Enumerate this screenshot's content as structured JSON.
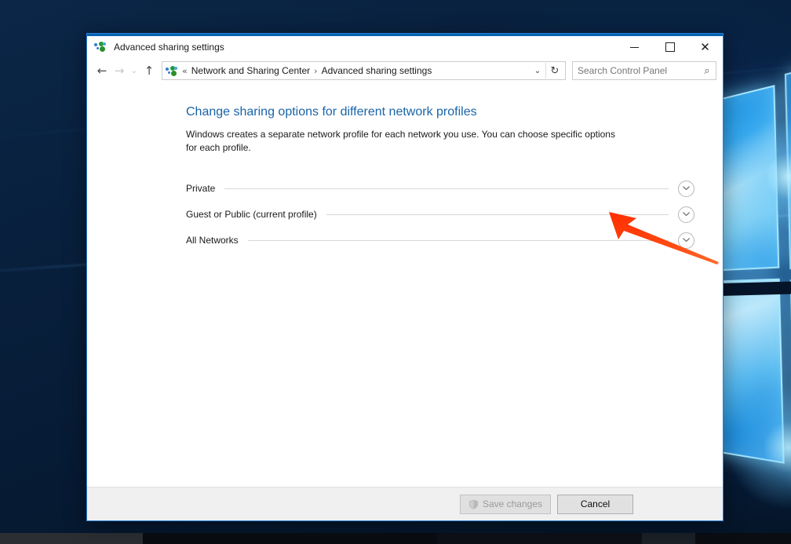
{
  "window": {
    "title": "Advanced sharing settings",
    "icon": "network-sharing-icon",
    "controls": {
      "minimize": "─",
      "maximize": "□",
      "close": "✕"
    }
  },
  "navigation": {
    "back": "←",
    "forward": "→",
    "recent": "⌄",
    "up": "↑"
  },
  "breadcrumb": {
    "leading_separator": "«",
    "separator": "›",
    "items": [
      {
        "label": "Network and Sharing Center"
      },
      {
        "label": "Advanced sharing settings"
      }
    ],
    "dropdown": "⌄",
    "refresh": "↻"
  },
  "search": {
    "placeholder": "Search Control Panel",
    "value": "",
    "icon": "search-icon"
  },
  "main": {
    "title": "Change sharing options for different network profiles",
    "description": "Windows creates a separate network profile for each network you use. You can choose specific options for each profile.",
    "profiles": [
      {
        "label": "Private",
        "expanded": false
      },
      {
        "label": "Guest or Public (current profile)",
        "expanded": false
      },
      {
        "label": "All Networks",
        "expanded": false
      }
    ]
  },
  "footer": {
    "save_label": "Save changes",
    "save_enabled": false,
    "save_icon": "uac-shield-icon",
    "cancel_label": "Cancel",
    "cancel_enabled": true
  },
  "annotation": {
    "type": "arrow",
    "color": "#FF3B0A",
    "points_to": "all-networks-expander"
  },
  "colors": {
    "accent": "#0063b1",
    "title_link": "#1964a8",
    "window_border": "#2a7fd0",
    "footer_bg": "#f0f0f0"
  }
}
